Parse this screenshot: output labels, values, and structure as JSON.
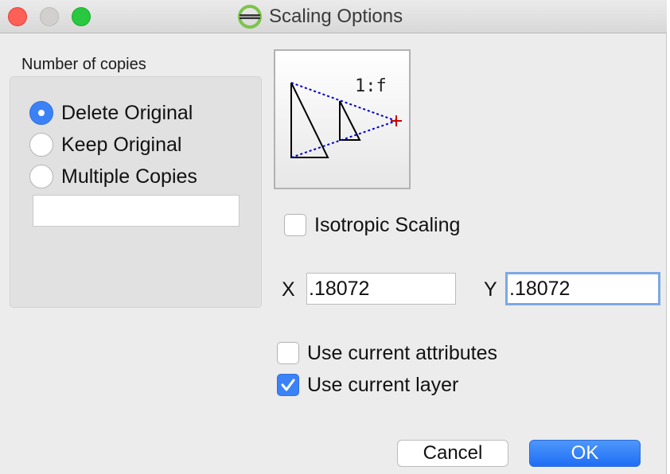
{
  "window": {
    "title": "Scaling Options",
    "controls": [
      "close",
      "minimize",
      "zoom"
    ],
    "app_icon": "scaling-tool-icon"
  },
  "copies": {
    "label": "Number of copies",
    "options": [
      {
        "label": "Delete Original",
        "selected": true
      },
      {
        "label": "Keep Original",
        "selected": false
      },
      {
        "label": "Multiple Copies",
        "selected": false
      }
    ],
    "count_value": ""
  },
  "preview": {
    "ratio_label": "1:f"
  },
  "scaling": {
    "isotropic_label": "Isotropic Scaling",
    "isotropic_checked": false,
    "x_label": "X",
    "x_value": ".18072",
    "y_label": "Y",
    "y_value": ".18072"
  },
  "options": {
    "attributes_label": "Use current attributes",
    "attributes_checked": false,
    "layer_label": "Use current layer",
    "layer_checked": true
  },
  "buttons": {
    "cancel": "Cancel",
    "ok": "OK"
  },
  "colors": {
    "accent": "#3b82f7",
    "close": "#fe5f57",
    "zoom": "#28c840",
    "guide_lines": "#0000cc",
    "origin_marker": "#cc0000"
  }
}
